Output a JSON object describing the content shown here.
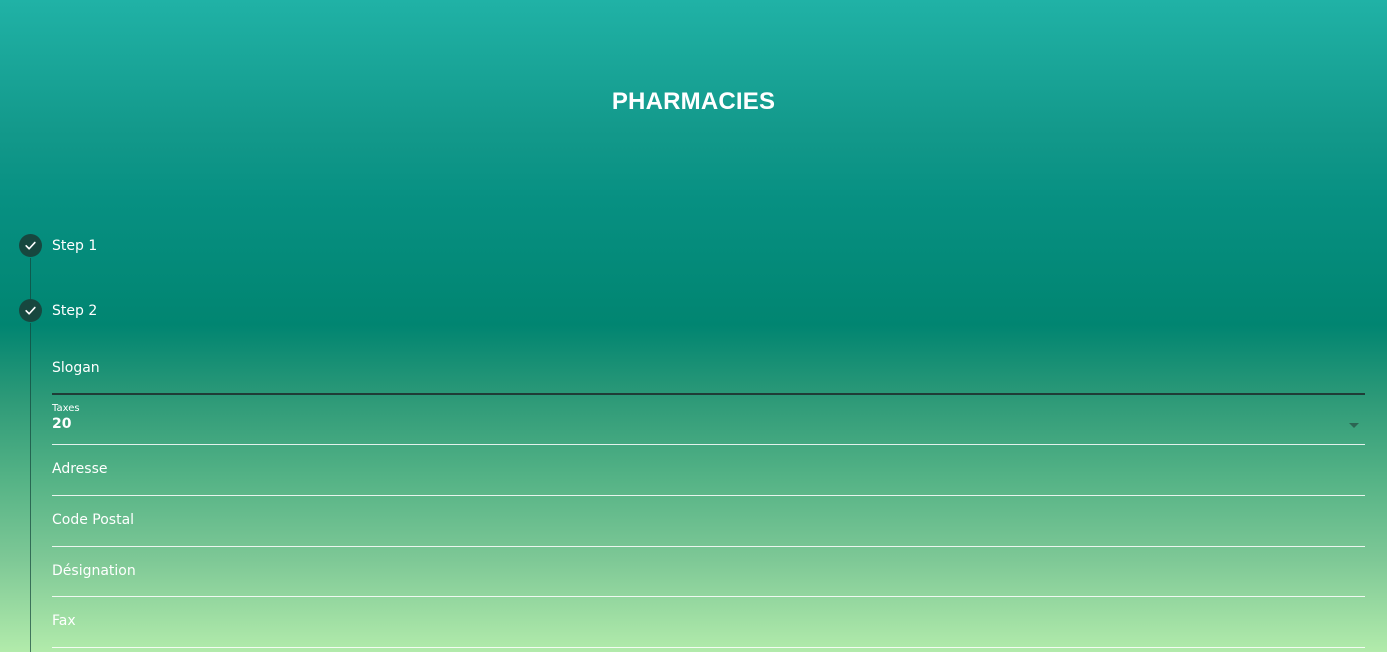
{
  "header": {
    "title": "PHARMACIES"
  },
  "stepper": {
    "steps": [
      {
        "label": "Step 1",
        "status": "completed",
        "icon": "check-icon"
      },
      {
        "label": "Step 2",
        "status": "completed",
        "icon": "check-icon"
      }
    ]
  },
  "form": {
    "slogan": {
      "label": "Slogan",
      "value": ""
    },
    "taxes": {
      "label": "Taxes",
      "value": "20"
    },
    "adresse": {
      "label": "Adresse",
      "value": ""
    },
    "code_postal": {
      "label": "Code Postal",
      "value": ""
    },
    "designation": {
      "label": "Désignation",
      "value": ""
    },
    "fax": {
      "label": "Fax",
      "value": ""
    }
  },
  "colors": {
    "gradient_top": "#20b2a6",
    "gradient_mid": "#018571",
    "gradient_bottom": "#b2ebab",
    "step_circle": "#17473f",
    "text": "#ffffff"
  }
}
